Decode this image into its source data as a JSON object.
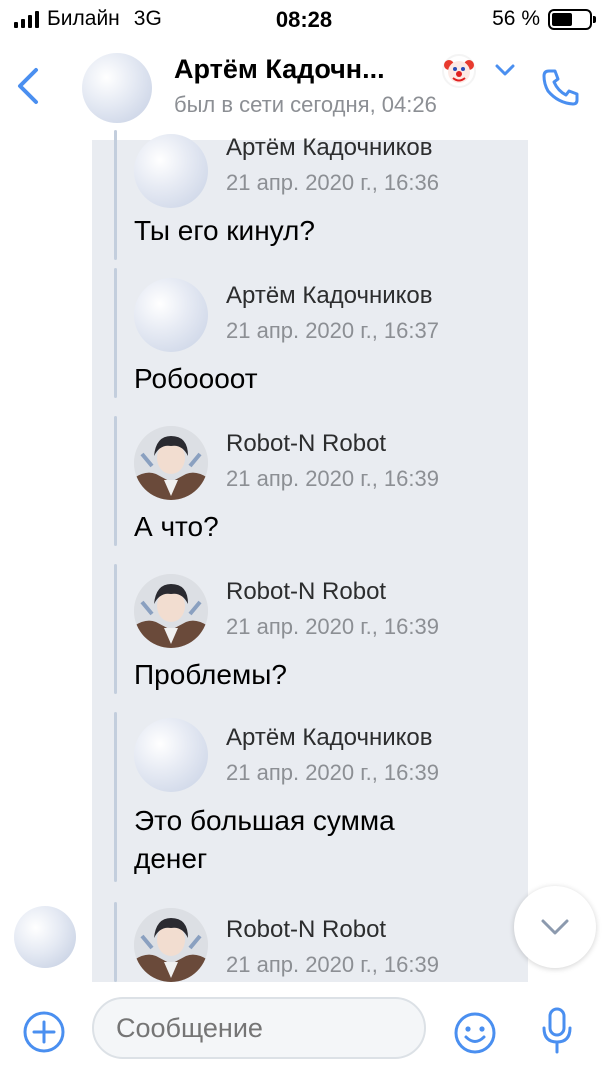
{
  "status_bar": {
    "carrier": "Билайн",
    "network": "3G",
    "time": "08:28",
    "battery_text": "56 %",
    "battery_level": 0.56
  },
  "header": {
    "contact_name": "Артём Кадочн...",
    "status": "был в сети сегодня, 04:26",
    "back_icon": "chevron-left-icon",
    "call_icon": "phone-icon",
    "emoji_badge": "clown-face-icon",
    "accent_color": "#4a8ff0"
  },
  "forwarded": [
    {
      "sender": "Артём Кадочников",
      "date": "21 апр. 2020 г., 16:36",
      "text": "Ты его кинул?",
      "avatar": "cloud"
    },
    {
      "sender": "Артём Кадочников",
      "date": "21 апр. 2020 г., 16:37",
      "text": "Робоооот",
      "avatar": "cloud"
    },
    {
      "sender": "Robot-N Robot",
      "date": "21 апр. 2020 г., 16:39",
      "text": "А что?",
      "avatar": "robot"
    },
    {
      "sender": "Robot-N Robot",
      "date": "21 апр. 2020 г., 16:39",
      "text": "Проблемы?",
      "avatar": "robot"
    },
    {
      "sender": "Артём Кадочников",
      "date": "21 апр. 2020 г., 16:39",
      "text": "Это большая сумма денег",
      "avatar": "cloud"
    },
    {
      "sender": "Robot-N Robot",
      "date": "21 апр. 2020 г., 16:39",
      "text": "",
      "avatar": "robot"
    }
  ],
  "composer": {
    "placeholder": "Сообщение",
    "add_icon": "plus-circle-icon",
    "emoji_icon": "smiley-icon",
    "mic_icon": "microphone-icon"
  },
  "scroll_button_icon": "chevron-down-icon"
}
